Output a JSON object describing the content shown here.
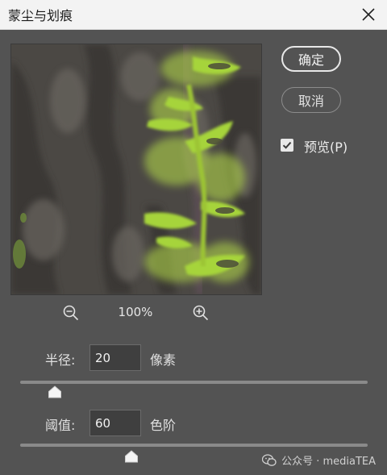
{
  "window": {
    "title": "蒙尘与划痕"
  },
  "buttons": {
    "ok_label": "确定",
    "cancel_label": "取消"
  },
  "preview_option": {
    "label": "预览(P)",
    "checked": true
  },
  "zoom": {
    "level": "100%"
  },
  "radius": {
    "label": "半径:",
    "value": "20",
    "unit": "像素",
    "slider_fraction": 0.1
  },
  "threshold": {
    "label": "阈值:",
    "value": "60",
    "unit": "色阶",
    "slider_fraction": 0.32
  },
  "watermark": {
    "text": "公众号 · mediaTEA"
  },
  "colors": {
    "dialog_bg": "#535353",
    "titlebar_bg": "#f3f3f3",
    "sprout_green": "#a6d43a",
    "bark_dark": "#3e3b38"
  }
}
